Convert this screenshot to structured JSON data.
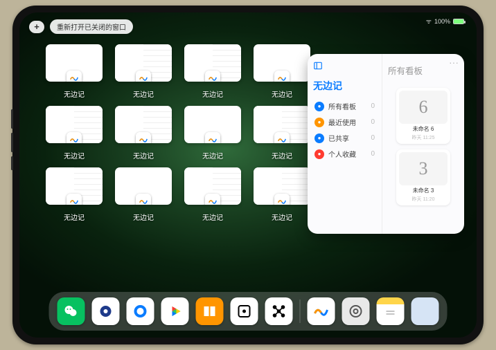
{
  "status": {
    "battery_pct": "100%",
    "battery_fill": 100
  },
  "topbar": {
    "plus": "+",
    "reopen_label": "重新打开已关闭的窗口"
  },
  "thumbs": [
    {
      "label": "无边记",
      "style": "blank"
    },
    {
      "label": "无边记",
      "style": "split"
    },
    {
      "label": "无边记",
      "style": "split"
    },
    {
      "label": "无边记",
      "style": "blank"
    },
    {
      "label": "无边记",
      "style": "split"
    },
    {
      "label": "无边记",
      "style": "split"
    },
    {
      "label": "无边记",
      "style": "blank"
    },
    {
      "label": "无边记",
      "style": "split"
    },
    {
      "label": "无边记",
      "style": "split"
    },
    {
      "label": "无边记",
      "style": "blank"
    },
    {
      "label": "无边记",
      "style": "split"
    },
    {
      "label": "无边记",
      "style": "split"
    }
  ],
  "popover": {
    "app_title": "无边记",
    "right_title": "所有看板",
    "more": "···",
    "nav": [
      {
        "color": "c-blue",
        "label": "所有看板",
        "count": "0"
      },
      {
        "color": "c-orange",
        "label": "最近使用",
        "count": "0"
      },
      {
        "color": "c-people",
        "label": "已共享",
        "count": "0"
      },
      {
        "color": "c-red",
        "label": "个人收藏",
        "count": "0"
      }
    ],
    "boards": [
      {
        "glyph": "6",
        "title": "未命名 6",
        "sub": "昨天 11:25"
      },
      {
        "glyph": "3",
        "title": "未命名 3",
        "sub": "昨天 11:20"
      }
    ]
  },
  "dock": [
    "wechat",
    "qq",
    "browser",
    "play",
    "books",
    "dice",
    "node",
    "freeform",
    "settings",
    "notes",
    "folder"
  ]
}
